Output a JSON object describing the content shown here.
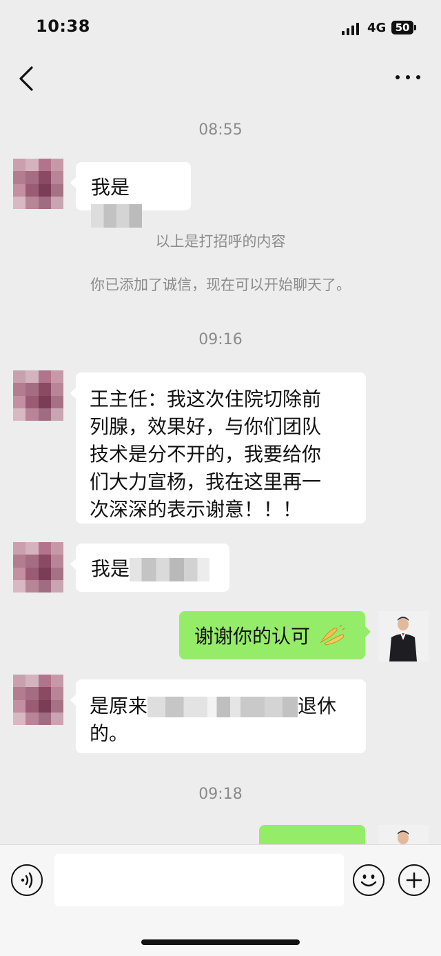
{
  "status_bar": {
    "time": "10:38",
    "network": "4G",
    "battery": "50"
  },
  "header": {
    "title": ""
  },
  "messages": [
    {
      "type": "timestamp",
      "text": "08:55"
    },
    {
      "type": "incoming",
      "prefix": "我是",
      "suffix": ""
    },
    {
      "type": "system",
      "text": "以上是打招呼的内容"
    },
    {
      "type": "system",
      "text": "你已添加了诚信，现在可以开始聊天了。"
    },
    {
      "type": "timestamp",
      "text": "09:16"
    },
    {
      "type": "incoming",
      "lines": [
        "王主任：我这次住院切除前",
        "列腺，效果好，与你们团队",
        "技术是分不开的，我要给你",
        "们大力宣杨，我在这里再一",
        "次深深的表示谢意！！！"
      ]
    },
    {
      "type": "incoming",
      "prefix": "我是",
      "suffix": ""
    },
    {
      "type": "outgoing",
      "text": "谢谢你的认可"
    },
    {
      "type": "incoming",
      "prefix": "是原来",
      "suffix": "退休",
      "line2": "的。"
    },
    {
      "type": "timestamp",
      "text": "09:18"
    },
    {
      "type": "outgoing",
      "text": ""
    }
  ],
  "icons": [
    "back-icon",
    "more-icon",
    "voice-icon",
    "emoji-icon",
    "plus-icon",
    "clap-emoji"
  ],
  "colors": {
    "background": "#ededed",
    "outgoing_bubble": "#95ec69",
    "incoming_bubble": "#ffffff",
    "system_text": "#8b8b8b"
  }
}
